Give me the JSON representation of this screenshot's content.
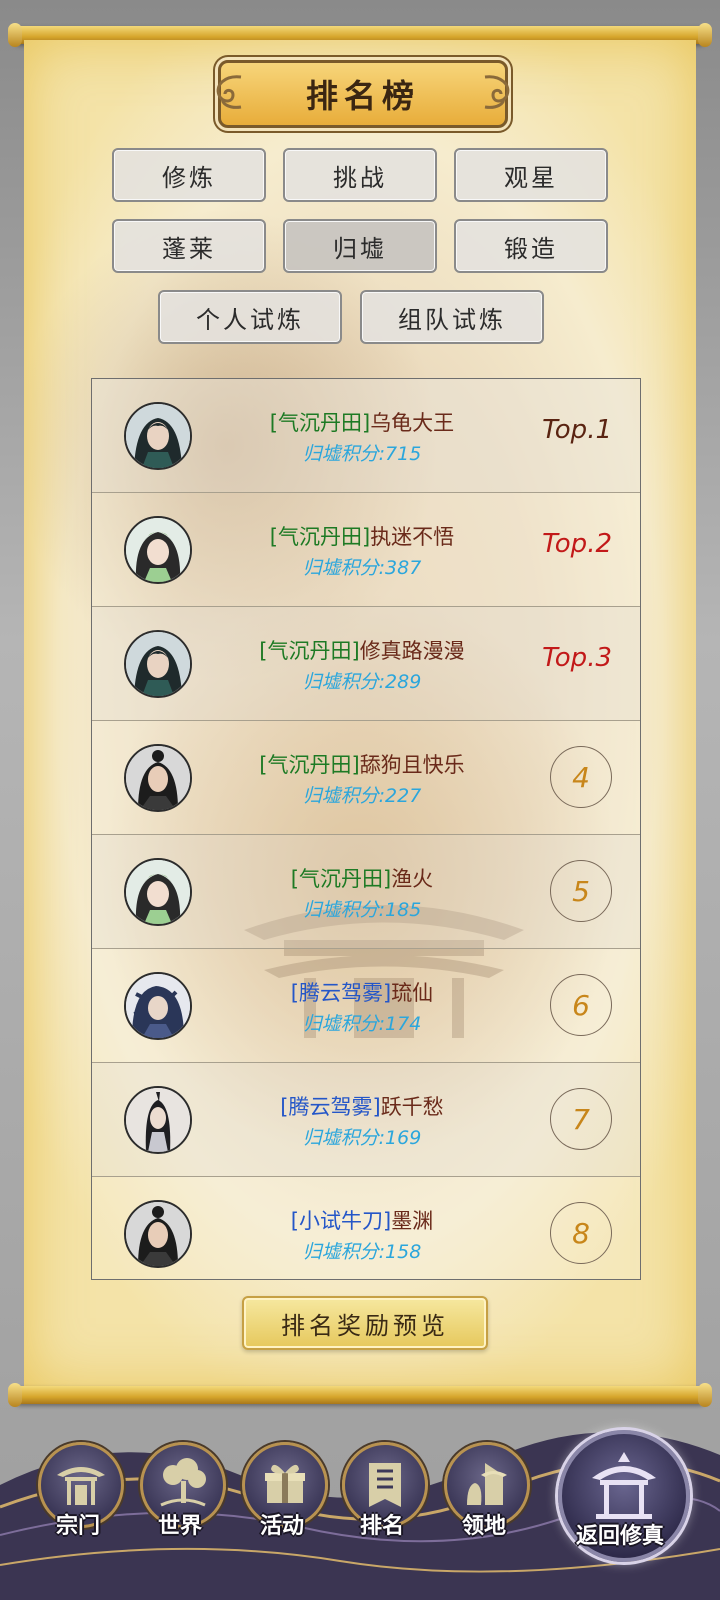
{
  "title": "排名榜",
  "tabs": [
    {
      "label": "修炼",
      "active": false
    },
    {
      "label": "挑战",
      "active": false
    },
    {
      "label": "观星",
      "active": false
    },
    {
      "label": "蓬莱",
      "active": false
    },
    {
      "label": "归墟",
      "active": true
    },
    {
      "label": "锻造",
      "active": false
    },
    {
      "label": "个人试炼",
      "active": false
    },
    {
      "label": "组队试炼",
      "active": false
    }
  ],
  "rankings": [
    {
      "realm": "[气沉丹田]",
      "name": "乌龟大王",
      "score": "归墟积分:715",
      "rank": "Top.1"
    },
    {
      "realm": "[气沉丹田]",
      "name": "执迷不悟",
      "score": "归墟积分:387",
      "rank": "Top.2"
    },
    {
      "realm": "[气沉丹田]",
      "name": "修真路漫漫",
      "score": "归墟积分:289",
      "rank": "Top.3"
    },
    {
      "realm": "[气沉丹田]",
      "name": "舔狗且快乐",
      "score": "归墟积分:227",
      "rank": "4"
    },
    {
      "realm": "[气沉丹田]",
      "name": "渔火",
      "score": "归墟积分:185",
      "rank": "5"
    },
    {
      "realm": "[腾云驾雾]",
      "name": "琉仙",
      "score": "归墟积分:174",
      "rank": "6"
    },
    {
      "realm": "[腾云驾雾]",
      "name": "跃千愁",
      "score": "归墟积分:169",
      "rank": "7"
    },
    {
      "realm": "[小试牛刀]",
      "name": "墨渊",
      "score": "归墟积分:158",
      "rank": "8"
    }
  ],
  "reward_button": "排名奖励预览",
  "nav": [
    {
      "label": "宗门",
      "icon": "sect-gate-icon"
    },
    {
      "label": "世界",
      "icon": "world-tree-icon"
    },
    {
      "label": "活动",
      "icon": "activity-gift-icon"
    },
    {
      "label": "排名",
      "icon": "ranking-banner-icon"
    },
    {
      "label": "领地",
      "icon": "territory-icon"
    }
  ],
  "return_button": "返回修真",
  "colors": {
    "realm_green": "#1d7a24",
    "realm_blue": "#2456c8",
    "score_cyan": "#2ba6dc",
    "top_red": "#c21919",
    "rank_orange": "#c8861a"
  }
}
